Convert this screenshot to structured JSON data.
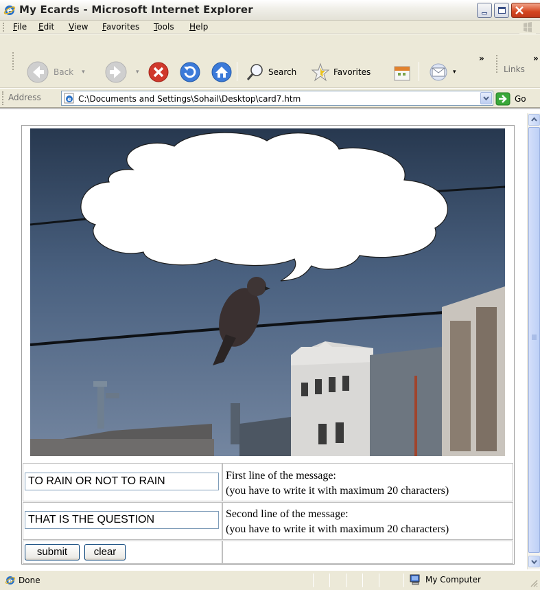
{
  "window": {
    "title": "My Ecards - Microsoft Internet Explorer"
  },
  "menu": [
    "File",
    "Edit",
    "View",
    "Favorites",
    "Tools",
    "Help"
  ],
  "toolbar": {
    "back_label": "Back",
    "search_label": "Search",
    "favorites_label": "Favorites",
    "links_label": "Links",
    "overflow": "»"
  },
  "address": {
    "label": "Address",
    "value": "C:\\Documents and Settings\\Sohail\\Desktop\\card7.htm",
    "go_label": "Go"
  },
  "card": {
    "line1_value": "TO RAIN OR NOT TO RAIN",
    "line1_desc_a": "First line of the message:",
    "line1_desc_b": "(you have to write it with maximum 20 characters)",
    "line2_value": "THAT IS THE QUESTION",
    "line2_desc_a": "Second line of the message:",
    "line2_desc_b": "(you have to write it with maximum 20 characters)",
    "submit_label": "submit",
    "clear_label": "clear"
  },
  "status": {
    "text": "Done",
    "zone": "My Computer"
  },
  "icons": {
    "app": "ie-icon",
    "back": "back-arrow-icon",
    "forward": "forward-arrow-icon",
    "stop": "stop-icon",
    "refresh": "refresh-icon",
    "home": "home-icon",
    "search": "search-icon",
    "favorites": "star-icon",
    "history": "history-icon",
    "mail": "mail-icon",
    "go": "go-arrow-icon",
    "computer": "computer-icon"
  },
  "colors": {
    "xp_chrome": "#ece9d8",
    "close_red": "#d4451f",
    "link_blue": "#0a246a"
  }
}
